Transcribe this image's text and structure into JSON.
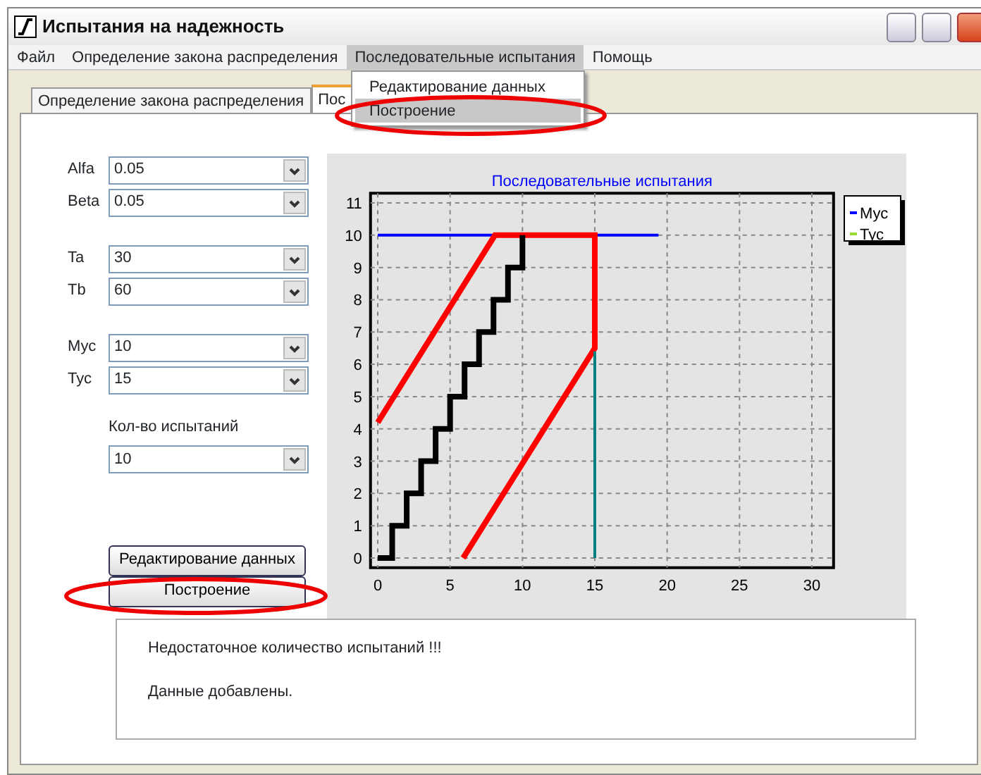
{
  "window": {
    "title": "Испытания на надежность"
  },
  "menu": [
    {
      "label": "Файл",
      "selected": false
    },
    {
      "label": "Определение закона распределения",
      "selected": false
    },
    {
      "label": "Последовательные испытания",
      "selected": true
    },
    {
      "label": "Помощь",
      "selected": false
    }
  ],
  "dropdown": [
    {
      "label": "Редактирование данных",
      "selected": false
    },
    {
      "label": "Построение",
      "selected": true
    }
  ],
  "tabs": [
    {
      "label": "Определение закона распределения",
      "selected": false
    },
    {
      "label": "Пос",
      "selected": true
    }
  ],
  "field_groups": [
    [
      {
        "label": "Alfa",
        "value": "0.05"
      },
      {
        "label": "Beta",
        "value": "0.05"
      }
    ],
    [
      {
        "label": "Ta",
        "value": "30"
      },
      {
        "label": "Tb",
        "value": "60"
      }
    ],
    [
      {
        "label": "Мус",
        "value": "10"
      },
      {
        "label": "Тус",
        "value": "15"
      }
    ]
  ],
  "trials": {
    "label": "Кол-во испытаний",
    "value": "10"
  },
  "buttons": [
    "Редактирование данных",
    "Построение"
  ],
  "chart": {
    "chart_data": {
      "type": "line",
      "grid": true,
      "title": "Последовательные испытания",
      "xlim": [
        -0.5,
        31.5
      ],
      "ylim": [
        -0.3,
        11.3
      ],
      "xticks": [
        0,
        5,
        10,
        15,
        20,
        25,
        30
      ],
      "yticks": [
        0,
        1,
        2,
        3,
        4,
        5,
        6,
        7,
        8,
        9,
        10,
        11
      ],
      "series": [
        {
          "color": "#0000ff",
          "x": [
            0,
            19.4
          ],
          "values": [
            10,
            10
          ]
        },
        {
          "color": "#ff0000",
          "x": [
            0,
            8.1,
            15,
            15,
            5.9
          ],
          "values": [
            4.2,
            10,
            10,
            6.5,
            0
          ]
        },
        {
          "color": "#000000",
          "x": [
            0,
            1,
            1,
            2,
            2,
            3,
            3,
            4,
            4,
            5,
            5,
            6,
            6,
            7,
            7,
            8,
            8,
            9,
            9,
            10,
            10
          ],
          "values": [
            0,
            0,
            1,
            1,
            2,
            2,
            3,
            3,
            4,
            4,
            5,
            5,
            6,
            6,
            7,
            7,
            8,
            8,
            9,
            9,
            10
          ]
        },
        {
          "color": "#008080",
          "x": [
            15,
            15
          ],
          "values": [
            0,
            6.4
          ]
        }
      ]
    },
    "legend": [
      {
        "label": "Мус",
        "color": "#0000ff"
      },
      {
        "label": "Тус",
        "color": "#99dd33"
      }
    ]
  },
  "messages": [
    "Недостаточное количество испытаний !!!",
    "Данные добавлены."
  ]
}
